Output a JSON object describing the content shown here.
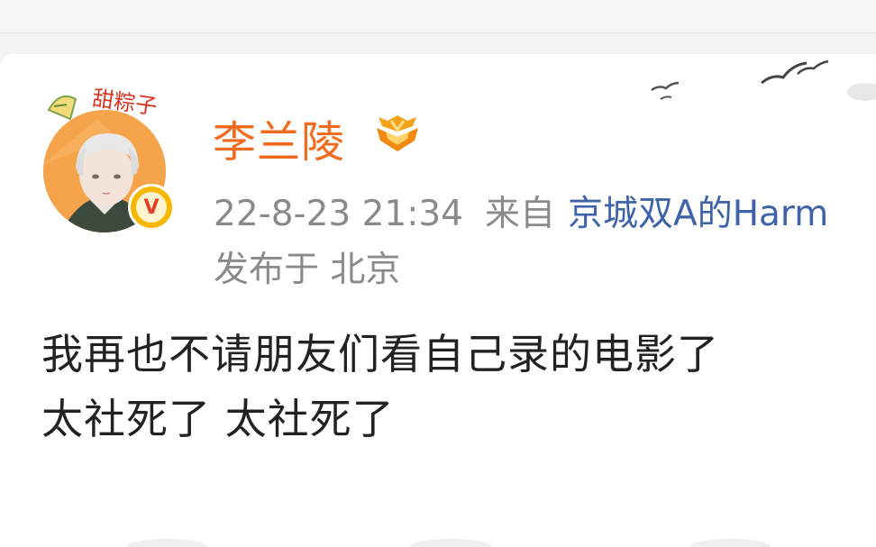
{
  "post": {
    "username": "李兰陵",
    "timestamp": "22-8-23 21:34",
    "source_prefix": "来自",
    "source_device": "京城双A的Harm",
    "location_line": "发布于 北京",
    "text_lines": [
      "我再也不请朋友们看自己录的电影了",
      "太社死了 太社死了"
    ]
  },
  "avatar": {
    "badge_letter": "V",
    "decoration_text": "甜粽子"
  },
  "icons": {
    "vip_badge": "vip-crown-badge-icon",
    "verified": "verified-v-icon",
    "background_birds": "birds-decoration-icon"
  },
  "colors": {
    "username": "#f26a1b",
    "link": "#3e63a8",
    "meta": "#8a8a8a",
    "text": "#222222",
    "avatar_bg": "#f6a44b",
    "badge": "#f6b800"
  }
}
